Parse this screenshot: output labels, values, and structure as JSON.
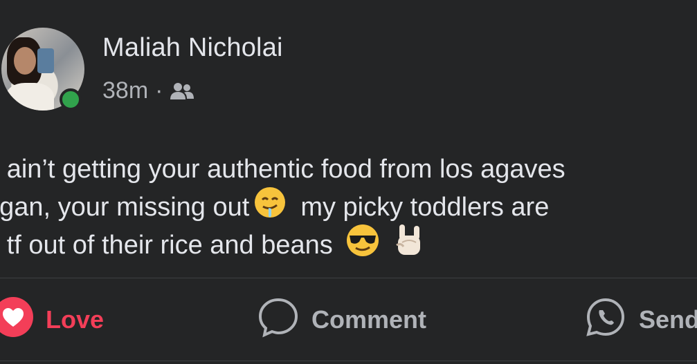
{
  "post": {
    "author": "Maliah Nicholai",
    "time": "38m",
    "separator": "·",
    "audience_icon": "friends-icon",
    "lines": [
      "u ain’t getting your authentic food from los agaves",
      "ogan, your missing out",
      "g tf out of their rice and beans"
    ],
    "line2_suffix": "my picky toddlers are"
  },
  "actions": {
    "love": "Love",
    "comment": "Comment",
    "send": "Send"
  },
  "colors": {
    "background": "#242526",
    "love": "#f33e58",
    "online": "#31a24c",
    "secondary_text": "#b0b3b8"
  }
}
